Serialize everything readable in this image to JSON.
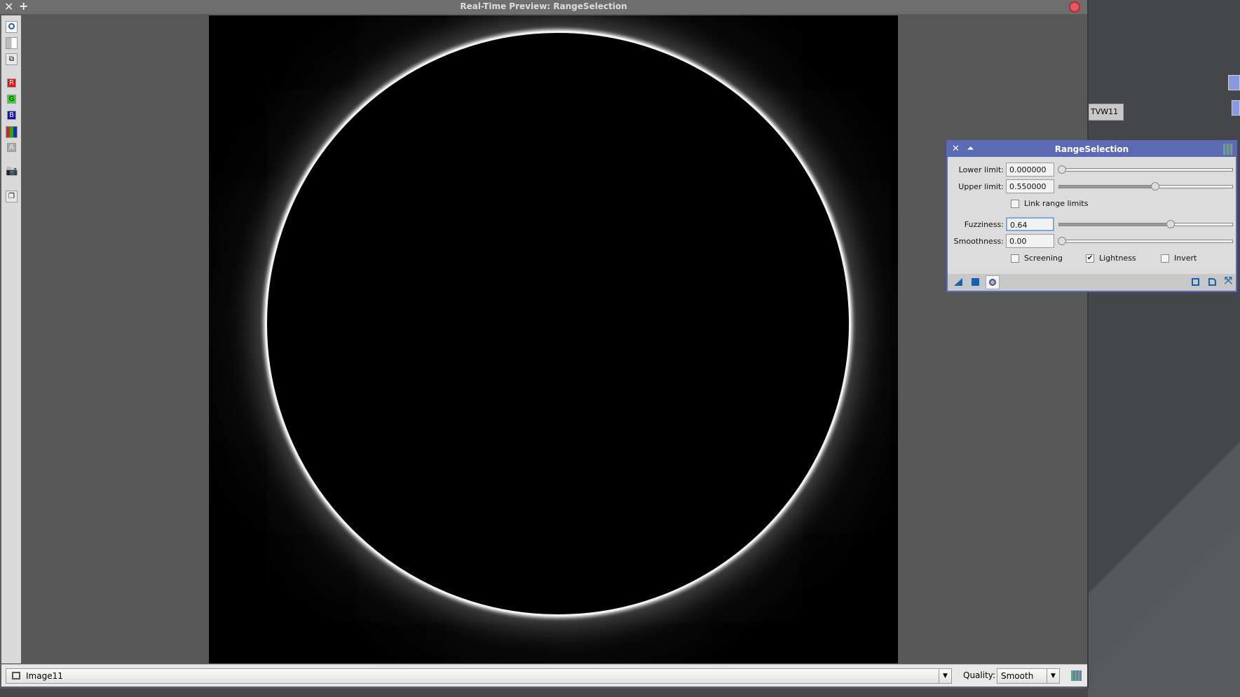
{
  "window": {
    "title": "Real-Time Preview: RangeSelection"
  },
  "toolbar": {
    "items": [
      "circle-mask",
      "checker",
      "overlap",
      "R",
      "G",
      "B",
      "RGB",
      "A",
      "camera",
      "window"
    ]
  },
  "bottom": {
    "view": "Image11",
    "quality_label": "Quality:",
    "quality_value": "Smooth"
  },
  "desktop": {
    "icon_label": "TVW11",
    "icon_flags": [
      "N",
      "D"
    ]
  },
  "dialog": {
    "title": "RangeSelection",
    "lower_label": "Lower limit:",
    "lower_value": "0.000000",
    "lower_fraction": 0.0,
    "upper_label": "Upper limit:",
    "upper_value": "0.550000",
    "upper_fraction": 0.55,
    "link_label": "Link range limits",
    "link_checked": false,
    "fuzz_label": "Fuzziness:",
    "fuzz_value": "0.64",
    "fuzz_fraction": 0.64,
    "smooth_label": "Smoothness:",
    "smooth_value": "0.00",
    "smooth_fraction": 0.0,
    "screening_label": "Screening",
    "screening_checked": false,
    "lightness_label": "Lightness",
    "lightness_checked": true,
    "invert_label": "Invert",
    "invert_checked": false,
    "accent": "#5b6ab5"
  }
}
